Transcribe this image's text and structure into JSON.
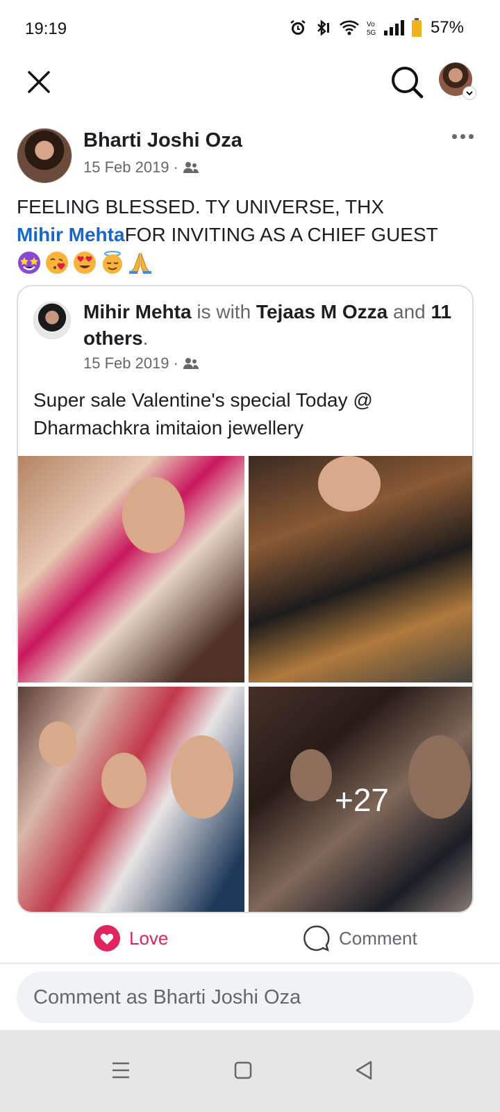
{
  "status_bar": {
    "time": "19:19",
    "battery": "57%",
    "icons": [
      "alarm-icon",
      "bluetooth-icon",
      "wifi-icon",
      "volte-icon",
      "signal-icon",
      "battery-icon"
    ]
  },
  "top_bar": {
    "icons": [
      "close-icon",
      "search-icon",
      "profile-avatar"
    ]
  },
  "post": {
    "author": "Bharti Joshi Oza",
    "date": "15 Feb 2019",
    "privacy_icon": "friends-icon",
    "text_line1": "FEELING BLESSED.  TY UNIVERSE,  THX",
    "mention": "Mihir Mehta",
    "text_line2": "FOR INVITING AS A CHIEF GUEST",
    "emojis": [
      "star-struck",
      "face-blowing-kiss",
      "heart-eyes",
      "smiling-face-with-halo",
      "folded-hands"
    ]
  },
  "shared_post": {
    "author": "Mihir Mehta",
    "is_with": "is with",
    "tagged": "Tejaas M Ozza",
    "and_text": "and",
    "others": "11 others",
    "period": ".",
    "date": "15 Feb 2019",
    "text": "Super sale Valentine's special Today @ Dharmachkra imitaion jewellery",
    "more_photos": "+27"
  },
  "actions": {
    "love": "Love",
    "comment": "Comment"
  },
  "comment_input": {
    "placeholder": "Comment as Bharti Joshi Oza"
  },
  "colors": {
    "link": "#1a66c7",
    "love": "#e0245e",
    "meta": "#65676b"
  }
}
